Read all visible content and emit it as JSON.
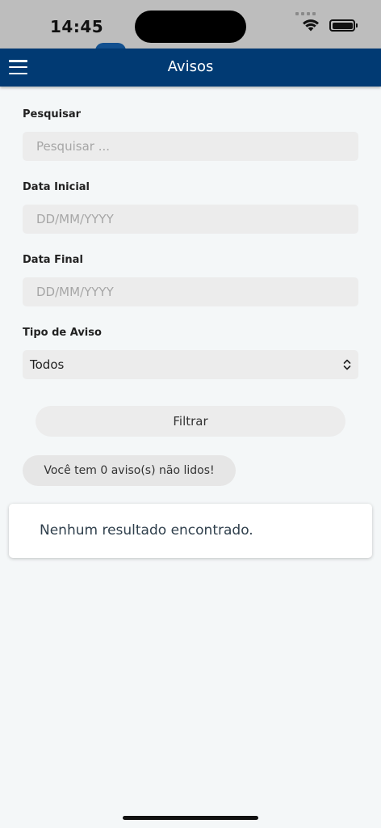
{
  "status_bar": {
    "time": "14:45"
  },
  "app_bar": {
    "title": "Avisos",
    "menu_icon": "hamburger-menu-icon"
  },
  "form": {
    "search": {
      "label": "Pesquisar",
      "placeholder": "Pesquisar ...",
      "value": ""
    },
    "start_date": {
      "label": "Data Inicial",
      "placeholder": "DD/MM/YYYY",
      "value": ""
    },
    "end_date": {
      "label": "Data Final",
      "placeholder": "DD/MM/YYYY",
      "value": ""
    },
    "notice_type": {
      "label": "Tipo de Aviso",
      "selected": "Todos"
    },
    "filter_button_label": "Filtrar"
  },
  "unread_summary": "Você tem 0 aviso(s) não lidos!",
  "results": {
    "empty_message": "Nenhum resultado encontrado."
  },
  "colors": {
    "app_bar": "#013a73",
    "background": "#f4f7f8",
    "input_bg": "#ececec"
  }
}
